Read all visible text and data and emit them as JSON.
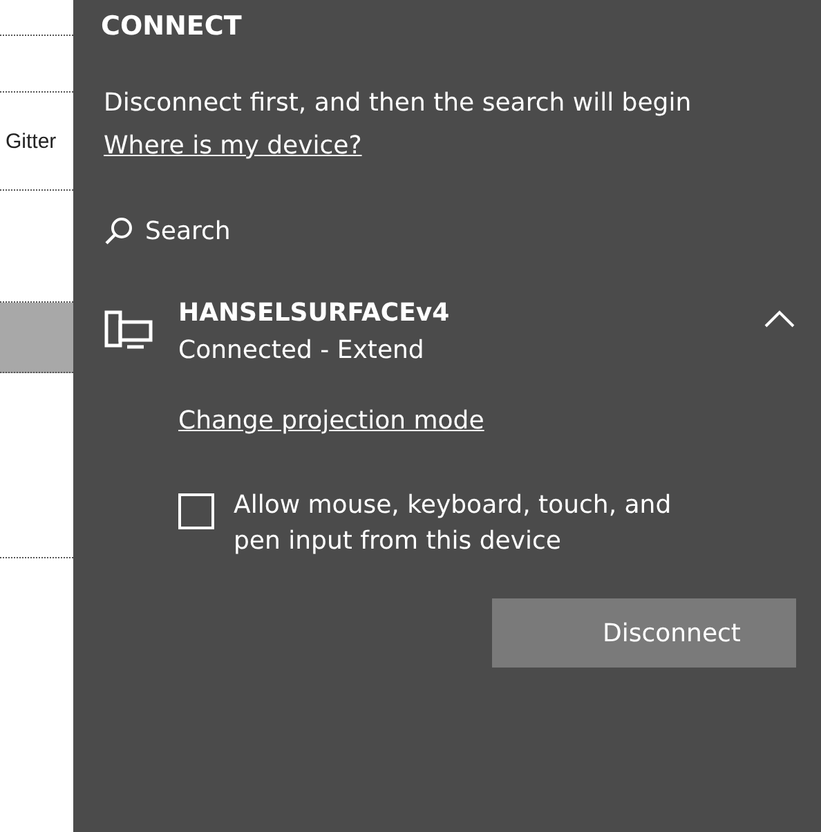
{
  "sidebar": {
    "label": "Gitter"
  },
  "panel": {
    "title": "CONNECT",
    "status": "Disconnect first, and then the search will begin",
    "help_link": "Where is my device?",
    "search_label": "Search",
    "device": {
      "name": "HANSELSURFACEv4",
      "status": "Connected - Extend",
      "expanded": true,
      "projection_link": "Change projection mode",
      "allow_input": {
        "label": "Allow mouse, keyboard, touch, and pen input from this device",
        "checked": false
      },
      "button": "Disconnect"
    }
  }
}
